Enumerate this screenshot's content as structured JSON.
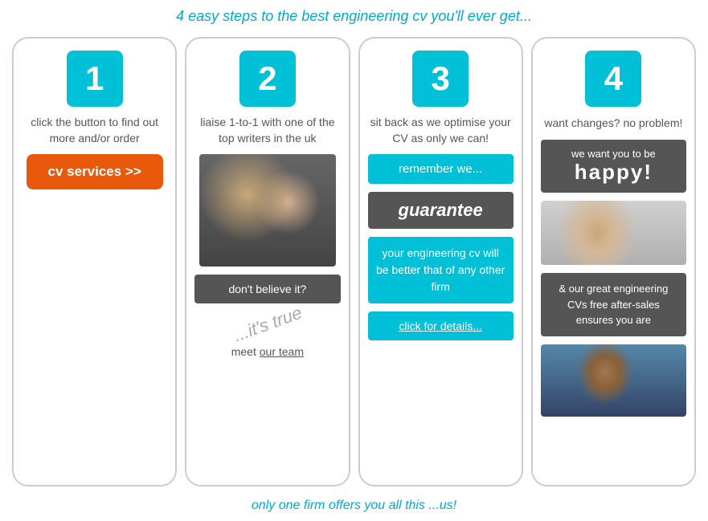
{
  "page": {
    "main_title": "4 easy steps to the best engineering cv you'll ever get...",
    "bottom_text": "only one firm offers you all this ...us!",
    "columns": [
      {
        "id": 1,
        "step_number": "1",
        "description": "click the button to find out more and/or order",
        "button_label": "cv services >>"
      },
      {
        "id": 2,
        "step_number": "2",
        "description": "liaise 1-to-1 with one of the top writers in the uk",
        "dont_believe": "don't believe it?",
        "its_true": "...it's true",
        "meet_team": "meet ",
        "team_link": "our team"
      },
      {
        "id": 3,
        "step_number": "3",
        "description": "sit back as we optimise your CV as only we can!",
        "remember": "remember we...",
        "guarantee": "guarantee",
        "engineering_cv": "your engineering cv will be better that of any other firm",
        "click_details": " for details..."
      },
      {
        "id": 4,
        "step_number": "4",
        "description": "want changes? no problem!",
        "we_want": "we want you to be",
        "happy": "happy!",
        "after_sales": "& our great engineering CVs free after-sales ensures you are"
      }
    ]
  }
}
